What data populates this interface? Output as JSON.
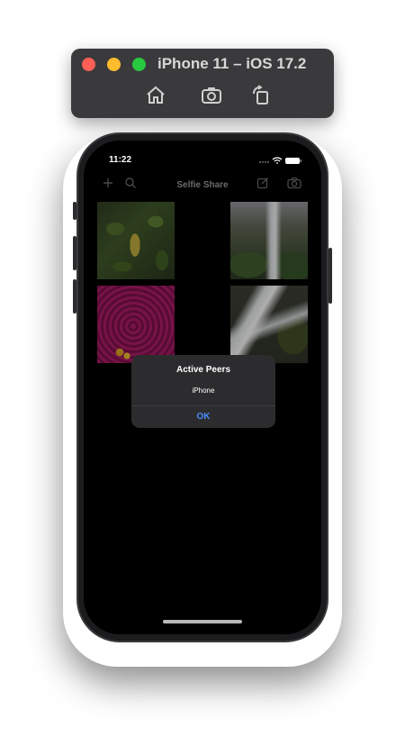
{
  "simulator": {
    "title": "iPhone 11 – iOS 17.2",
    "buttons": [
      "home-icon",
      "screenshot-icon",
      "rotate-icon"
    ]
  },
  "status_bar": {
    "time": "11:22"
  },
  "nav": {
    "title": "Selfie Share",
    "left_icons": [
      "plus-icon",
      "search-icon"
    ],
    "right_icons": [
      "compose-icon",
      "camera-icon"
    ]
  },
  "photos": [
    "leaves",
    "waterfall",
    "pink-flowers",
    "rapids"
  ],
  "alert": {
    "title": "Active Peers",
    "message": "iPhone",
    "ok_label": "OK"
  },
  "colors": {
    "accent": "#4a8cff",
    "alert_bg": "#2c2c2e",
    "screen_bg": "#000000"
  }
}
